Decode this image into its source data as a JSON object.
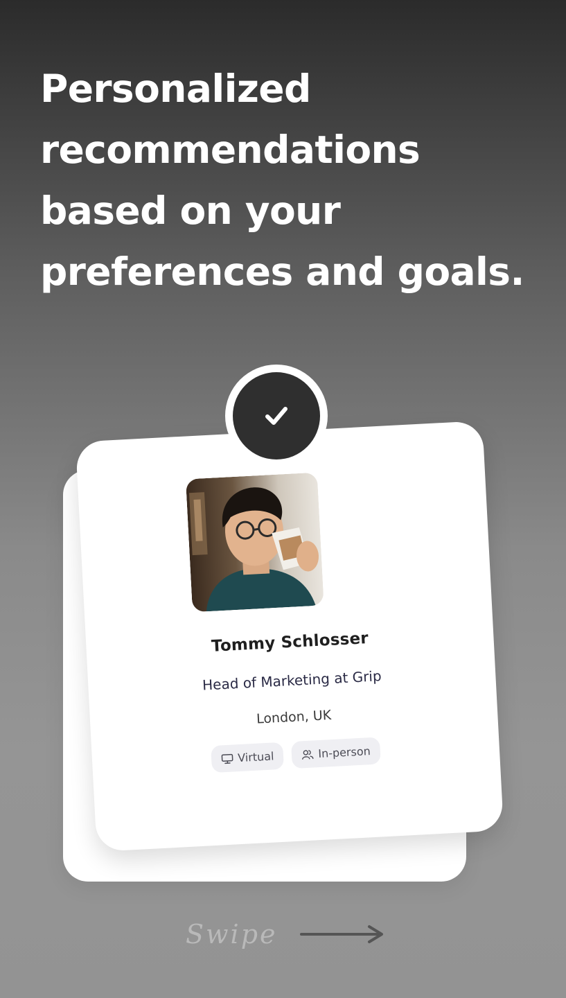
{
  "headline": "Personalized recommendations based on your preferences and goals.",
  "profile": {
    "name": "Tommy Schlosser",
    "role": "Head of Marketing at Grip",
    "location": "London, UK",
    "tags": [
      {
        "label": "Virtual",
        "icon": "monitor-icon"
      },
      {
        "label": "In-person",
        "icon": "people-icon"
      }
    ]
  },
  "swipe": {
    "label": "Swipe",
    "icon": "arrow-right-icon"
  },
  "colors": {
    "check_disc": "#2f2f2f",
    "card": "#ffffff",
    "tag_bg": "#efeff3"
  }
}
